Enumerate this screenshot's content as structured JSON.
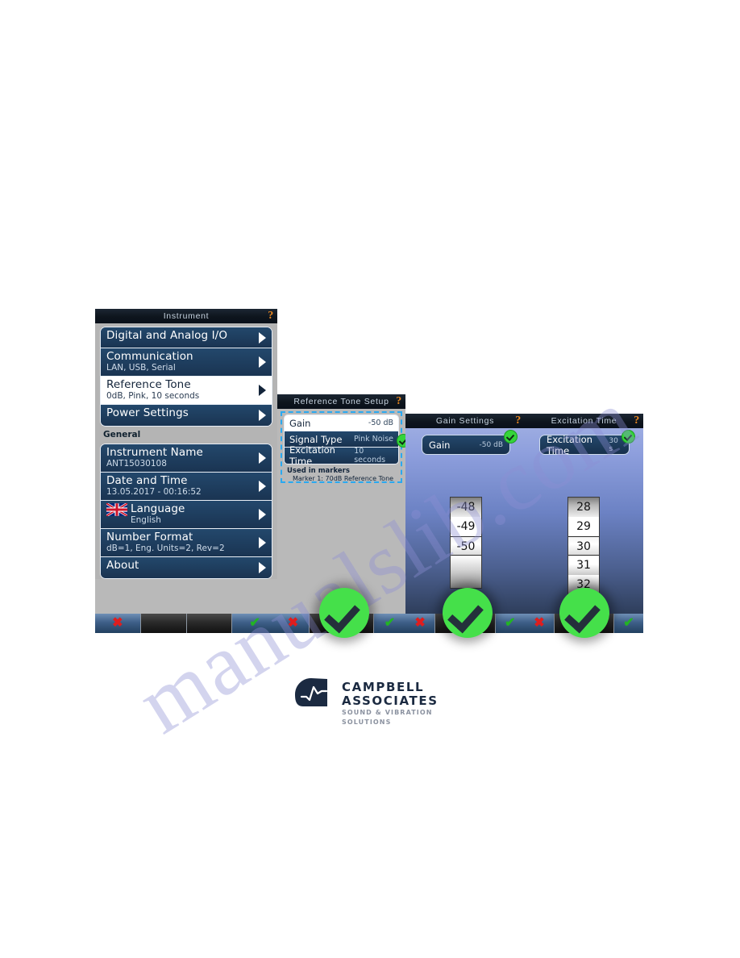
{
  "watermark": {
    "text": "manualslib.com"
  },
  "panel_instrument": {
    "title": "Instrument",
    "help_icon": "?",
    "rows": [
      {
        "title": "Digital and Analog I/O",
        "sub": "",
        "highlight": false
      },
      {
        "title": "Communication",
        "sub": "LAN, USB, Serial",
        "highlight": false
      },
      {
        "title": "Reference Tone",
        "sub": "0dB, Pink, 10 seconds",
        "highlight": true
      },
      {
        "title": "Power Settings",
        "sub": "",
        "highlight": false
      }
    ],
    "group_label": "General",
    "general_rows": [
      {
        "title": "Instrument Name",
        "sub": "ANT15030108",
        "highlight": false
      },
      {
        "title": "Date and Time",
        "sub": "13.05.2017 - 00:16:52",
        "highlight": false
      },
      {
        "title": "Language",
        "sub": "English",
        "highlight": false,
        "flag": "uk-flag-icon"
      },
      {
        "title": "Number Format",
        "sub": "dB=1, Eng. Units=2, Rev=2",
        "highlight": false
      },
      {
        "title": "About",
        "sub": "",
        "highlight": false
      }
    ],
    "softkeys": [
      {
        "glyph": "✖",
        "kind": "x",
        "style": "blue"
      },
      {
        "glyph": "",
        "kind": "none",
        "style": "dark"
      },
      {
        "glyph": "",
        "kind": "none",
        "style": "dark"
      },
      {
        "glyph": "✔",
        "kind": "tick",
        "style": "blue"
      }
    ]
  },
  "panel_reftone": {
    "title": "Reference Tone Setup",
    "help_icon": "?",
    "rows": [
      {
        "label": "Gain",
        "value": "-50 dB",
        "selected": true
      },
      {
        "label": "Signal Type",
        "value": "Pink Noise",
        "selected": false
      },
      {
        "label": "Excitation Time",
        "value": "10 seconds",
        "selected": false
      }
    ],
    "note_title": "Used in markers",
    "note_detail": "Marker 1: 70dB Reference Tone",
    "softkeys": [
      {
        "glyph": "✖",
        "kind": "x",
        "style": "blue"
      },
      {
        "glyph": "",
        "kind": "none",
        "style": "dark"
      },
      {
        "glyph": "",
        "kind": "none",
        "style": "dark"
      },
      {
        "glyph": "✔",
        "kind": "tick",
        "style": "blue"
      }
    ]
  },
  "panel_gain": {
    "title": "Gain Settings",
    "help_icon": "?",
    "pill_label": "Gain",
    "pill_value": "-50 dB",
    "spinner": {
      "items": [
        "-48",
        "-49",
        "-50",
        ""
      ],
      "selected_index": 2,
      "selected_value": "-50"
    },
    "softkeys": [
      {
        "glyph": "✖",
        "kind": "x",
        "style": "blue"
      },
      {
        "glyph": "",
        "kind": "none",
        "style": "dark"
      },
      {
        "glyph": "",
        "kind": "none",
        "style": "dark"
      },
      {
        "glyph": "✔",
        "kind": "tick",
        "style": "blue"
      }
    ]
  },
  "panel_excitation": {
    "title": "Excitation Time",
    "help_icon": "?",
    "pill_label": "Excitation Time",
    "pill_value": "30 s",
    "spinner": {
      "items": [
        "28",
        "29",
        "30",
        "31",
        "32"
      ],
      "selected_index": 2,
      "selected_value": "30"
    },
    "softkeys": [
      {
        "glyph": "✖",
        "kind": "x",
        "style": "blue"
      },
      {
        "glyph": "",
        "kind": "none",
        "style": "dark"
      },
      {
        "glyph": "",
        "kind": "none",
        "style": "dark"
      },
      {
        "glyph": "✔",
        "kind": "tick",
        "style": "blue"
      }
    ]
  },
  "callouts": [
    {
      "name": "confirm-step-1",
      "glyph": "✔"
    },
    {
      "name": "confirm-step-2",
      "glyph": "✔"
    },
    {
      "name": "confirm-step-3",
      "glyph": "✔"
    }
  ],
  "logo": {
    "name": "CAMPBELL ASSOCIATES",
    "tagline": "SOUND & VIBRATION SOLUTIONS"
  },
  "colors": {
    "accent_green": "#45e04a",
    "help_orange": "#e8861f",
    "focus_blue": "#2aa9f0",
    "menu_blue": "#23486c",
    "watermark": "#8d8fd4"
  }
}
